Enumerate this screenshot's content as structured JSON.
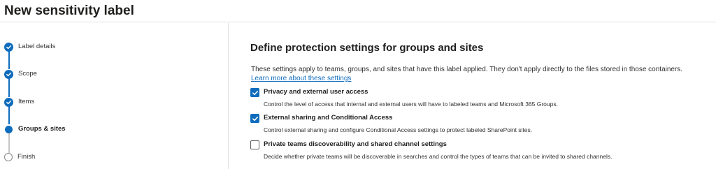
{
  "header": {
    "title": "New sensitivity label"
  },
  "wizard": {
    "steps": [
      {
        "label": "Label details",
        "status": "complete"
      },
      {
        "label": "Scope",
        "status": "complete"
      },
      {
        "label": "Items",
        "status": "complete"
      },
      {
        "label": "Groups & sites",
        "status": "current"
      },
      {
        "label": "Finish",
        "status": "pending"
      }
    ]
  },
  "main": {
    "title": "Define protection settings for groups and sites",
    "description": "These settings apply to teams, groups, and sites that have this label applied. They don't apply directly to the files stored in those containers.",
    "learn_more": "Learn more about these settings",
    "options": [
      {
        "label": "Privacy and external user access",
        "description": "Control the level of access that internal and external users will have to labeled teams and Microsoft 365 Groups.",
        "checked": true
      },
      {
        "label": "External sharing and Conditional Access",
        "description": "Control external sharing and configure Conditional Access settings to protect labeled SharePoint sites.",
        "checked": true
      },
      {
        "label": "Private teams discoverability and shared channel settings",
        "description": "Decide whether private teams will be discoverable in searches and control the types of teams that can be invited to shared channels.",
        "checked": false
      }
    ]
  },
  "colors": {
    "accent": "#0f6cbd",
    "text": "#323130",
    "divider": "#e1dfdd"
  }
}
